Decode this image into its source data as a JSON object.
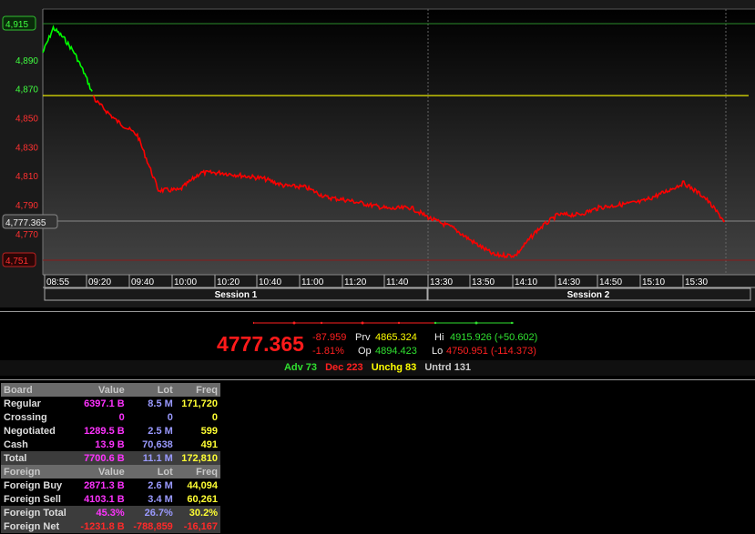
{
  "chart": {
    "y_ticks": [
      "4,890",
      "4,870",
      "4,850",
      "4,830",
      "4,810",
      "4,790",
      "4,770"
    ],
    "top_label": "4,915",
    "current_label": "4,777.365",
    "bottom_label": "4,751",
    "x_ticks": [
      "08:55",
      "09:20",
      "09:40",
      "10:00",
      "10:20",
      "10:40",
      "11:00",
      "11:20",
      "11:40",
      "13:30",
      "13:50",
      "14:10",
      "14:30",
      "14:50",
      "15:10",
      "15:30"
    ],
    "sessions": [
      "Session 1",
      "Session 2"
    ],
    "colors": {
      "up": "#00ff00",
      "down": "#ff0000",
      "prev_line": "#ffff00"
    }
  },
  "chart_data": {
    "type": "line",
    "x": [
      "08:55",
      "09:00",
      "09:05",
      "09:10",
      "09:15",
      "09:20",
      "09:30",
      "09:40",
      "09:50",
      "10:00",
      "10:10",
      "10:20",
      "10:30",
      "10:40",
      "10:50",
      "11:00",
      "11:10",
      "11:20",
      "11:30",
      "11:40",
      "11:50",
      "13:30",
      "13:40",
      "13:50",
      "14:00",
      "14:10",
      "14:20",
      "14:30",
      "14:40",
      "14:50",
      "15:00",
      "15:10",
      "15:20",
      "15:30",
      "15:40",
      "15:50"
    ],
    "y": [
      4895,
      4912,
      4905,
      4895,
      4880,
      4862,
      4848,
      4838,
      4800,
      4800,
      4812,
      4812,
      4810,
      4808,
      4803,
      4802,
      4795,
      4793,
      4790,
      4787,
      4788,
      4780,
      4774,
      4764,
      4755,
      4755,
      4772,
      4783,
      4783,
      4788,
      4790,
      4792,
      4798,
      4805,
      4795,
      4777.365
    ],
    "prev_close": 4865.324,
    "ylim": [
      4751,
      4915
    ],
    "grid": false
  },
  "summary": {
    "index": "4777.365",
    "change": "-87.959",
    "change_pct": "-1.81%",
    "prev_label": "Prv",
    "prev": "4865.324",
    "open_label": "Op",
    "open": "4894.423",
    "high_label": "Hi",
    "high": "4915.926 (+50.602)",
    "low_label": "Lo",
    "low": "4750.951 (-114.373)",
    "adv": "Adv 73",
    "dec": "Dec 223",
    "unchg": "Unchg 83",
    "untrd": "Untrd 131"
  },
  "board": {
    "header": [
      "Board",
      "Value",
      "Lot",
      "Freq"
    ],
    "rows": [
      {
        "name": "Regular",
        "value": "6397.1 B",
        "lot": "8.5 M",
        "freq": "171,720"
      },
      {
        "name": "Crossing",
        "value": "0",
        "lot": "0",
        "freq": "0"
      },
      {
        "name": "Negotiated",
        "value": "1289.5 B",
        "lot": "2.5 M",
        "freq": "599"
      },
      {
        "name": "Cash",
        "value": "13.9 B",
        "lot": "70,638",
        "freq": "491"
      }
    ],
    "total": {
      "name": "Total",
      "value": "7700.6 B",
      "lot": "11.1 M",
      "freq": "172,810"
    },
    "foreign_header": [
      "Foreign",
      "Value",
      "Lot",
      "Freq"
    ],
    "foreign_rows": [
      {
        "name": "Foreign Buy",
        "value": "2871.3 B",
        "lot": "2.6 M",
        "freq": "44,094"
      },
      {
        "name": "Foreign Sell",
        "value": "4103.1 B",
        "lot": "3.4 M",
        "freq": "60,261"
      }
    ],
    "foreign_total": {
      "name": "Foreign Total",
      "value": "45.3%",
      "lot": "26.7%",
      "freq": "30.2%"
    },
    "foreign_net": {
      "name": "Foreign Net",
      "value": "-1231.8 B",
      "lot": "-788,859",
      "freq": "-16,167"
    }
  }
}
